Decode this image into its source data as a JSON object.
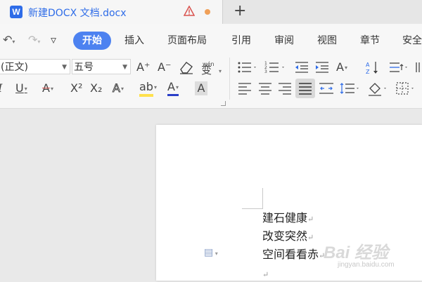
{
  "tab": {
    "icon_letter": "W",
    "title": "新建DOCX 文档.docx",
    "new_tab": "+"
  },
  "quick_access": {
    "undo": "↶",
    "redo": "↷",
    "more": "▿"
  },
  "menu": {
    "items": [
      "开始",
      "插入",
      "页面布局",
      "引用",
      "审阅",
      "视图",
      "章节",
      "安全"
    ],
    "active_index": 0
  },
  "font": {
    "name_value": "(正文)",
    "size_value": "五号"
  },
  "toolbar": {
    "grow_font": "A⁺",
    "shrink_font": "A⁻",
    "phonetic_label": "wén",
    "phonetic_char": "变",
    "italic": "I",
    "underline": "U",
    "strikethrough": "A",
    "superscript": "X²",
    "subscript": "X₂",
    "text_effect": "A",
    "highlight": "ab",
    "font_color": "A",
    "char_shading": "A"
  },
  "document": {
    "lines": [
      "建石健康",
      "改变突然",
      "空间看看赤"
    ],
    "paragraph_mark": "↵"
  },
  "watermark": {
    "main": "Bai 经验",
    "sub": "jingyan.baidu.com"
  },
  "colors": {
    "accent": "#4d82f0",
    "doc_icon": "#2e6ce8",
    "warning": "#d9534f",
    "unsaved_dot": "#f0a058",
    "highlight_bar": "#ffe14d",
    "font_color_bar": "#2a3fc8",
    "strike_color": "#d9534f"
  }
}
